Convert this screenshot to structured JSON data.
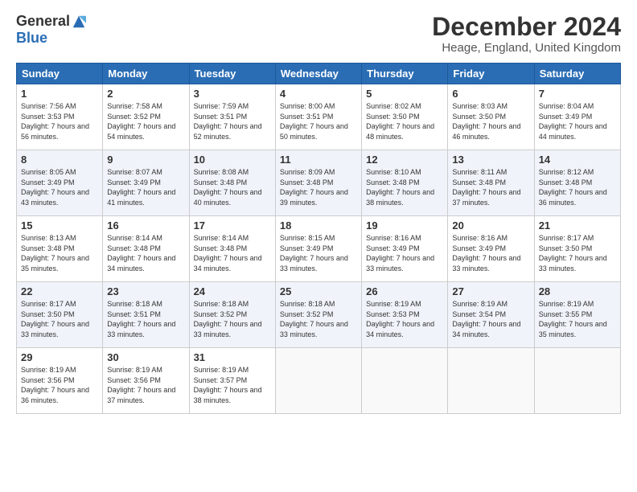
{
  "logo": {
    "general": "General",
    "blue": "Blue"
  },
  "title": "December 2024",
  "location": "Heage, England, United Kingdom",
  "days_of_week": [
    "Sunday",
    "Monday",
    "Tuesday",
    "Wednesday",
    "Thursday",
    "Friday",
    "Saturday"
  ],
  "weeks": [
    [
      {
        "day": "1",
        "sunrise": "Sunrise: 7:56 AM",
        "sunset": "Sunset: 3:53 PM",
        "daylight": "Daylight: 7 hours and 56 minutes."
      },
      {
        "day": "2",
        "sunrise": "Sunrise: 7:58 AM",
        "sunset": "Sunset: 3:52 PM",
        "daylight": "Daylight: 7 hours and 54 minutes."
      },
      {
        "day": "3",
        "sunrise": "Sunrise: 7:59 AM",
        "sunset": "Sunset: 3:51 PM",
        "daylight": "Daylight: 7 hours and 52 minutes."
      },
      {
        "day": "4",
        "sunrise": "Sunrise: 8:00 AM",
        "sunset": "Sunset: 3:51 PM",
        "daylight": "Daylight: 7 hours and 50 minutes."
      },
      {
        "day": "5",
        "sunrise": "Sunrise: 8:02 AM",
        "sunset": "Sunset: 3:50 PM",
        "daylight": "Daylight: 7 hours and 48 minutes."
      },
      {
        "day": "6",
        "sunrise": "Sunrise: 8:03 AM",
        "sunset": "Sunset: 3:50 PM",
        "daylight": "Daylight: 7 hours and 46 minutes."
      },
      {
        "day": "7",
        "sunrise": "Sunrise: 8:04 AM",
        "sunset": "Sunset: 3:49 PM",
        "daylight": "Daylight: 7 hours and 44 minutes."
      }
    ],
    [
      {
        "day": "8",
        "sunrise": "Sunrise: 8:05 AM",
        "sunset": "Sunset: 3:49 PM",
        "daylight": "Daylight: 7 hours and 43 minutes."
      },
      {
        "day": "9",
        "sunrise": "Sunrise: 8:07 AM",
        "sunset": "Sunset: 3:49 PM",
        "daylight": "Daylight: 7 hours and 41 minutes."
      },
      {
        "day": "10",
        "sunrise": "Sunrise: 8:08 AM",
        "sunset": "Sunset: 3:48 PM",
        "daylight": "Daylight: 7 hours and 40 minutes."
      },
      {
        "day": "11",
        "sunrise": "Sunrise: 8:09 AM",
        "sunset": "Sunset: 3:48 PM",
        "daylight": "Daylight: 7 hours and 39 minutes."
      },
      {
        "day": "12",
        "sunrise": "Sunrise: 8:10 AM",
        "sunset": "Sunset: 3:48 PM",
        "daylight": "Daylight: 7 hours and 38 minutes."
      },
      {
        "day": "13",
        "sunrise": "Sunrise: 8:11 AM",
        "sunset": "Sunset: 3:48 PM",
        "daylight": "Daylight: 7 hours and 37 minutes."
      },
      {
        "day": "14",
        "sunrise": "Sunrise: 8:12 AM",
        "sunset": "Sunset: 3:48 PM",
        "daylight": "Daylight: 7 hours and 36 minutes."
      }
    ],
    [
      {
        "day": "15",
        "sunrise": "Sunrise: 8:13 AM",
        "sunset": "Sunset: 3:48 PM",
        "daylight": "Daylight: 7 hours and 35 minutes."
      },
      {
        "day": "16",
        "sunrise": "Sunrise: 8:14 AM",
        "sunset": "Sunset: 3:48 PM",
        "daylight": "Daylight: 7 hours and 34 minutes."
      },
      {
        "day": "17",
        "sunrise": "Sunrise: 8:14 AM",
        "sunset": "Sunset: 3:48 PM",
        "daylight": "Daylight: 7 hours and 34 minutes."
      },
      {
        "day": "18",
        "sunrise": "Sunrise: 8:15 AM",
        "sunset": "Sunset: 3:49 PM",
        "daylight": "Daylight: 7 hours and 33 minutes."
      },
      {
        "day": "19",
        "sunrise": "Sunrise: 8:16 AM",
        "sunset": "Sunset: 3:49 PM",
        "daylight": "Daylight: 7 hours and 33 minutes."
      },
      {
        "day": "20",
        "sunrise": "Sunrise: 8:16 AM",
        "sunset": "Sunset: 3:49 PM",
        "daylight": "Daylight: 7 hours and 33 minutes."
      },
      {
        "day": "21",
        "sunrise": "Sunrise: 8:17 AM",
        "sunset": "Sunset: 3:50 PM",
        "daylight": "Daylight: 7 hours and 33 minutes."
      }
    ],
    [
      {
        "day": "22",
        "sunrise": "Sunrise: 8:17 AM",
        "sunset": "Sunset: 3:50 PM",
        "daylight": "Daylight: 7 hours and 33 minutes."
      },
      {
        "day": "23",
        "sunrise": "Sunrise: 8:18 AM",
        "sunset": "Sunset: 3:51 PM",
        "daylight": "Daylight: 7 hours and 33 minutes."
      },
      {
        "day": "24",
        "sunrise": "Sunrise: 8:18 AM",
        "sunset": "Sunset: 3:52 PM",
        "daylight": "Daylight: 7 hours and 33 minutes."
      },
      {
        "day": "25",
        "sunrise": "Sunrise: 8:18 AM",
        "sunset": "Sunset: 3:52 PM",
        "daylight": "Daylight: 7 hours and 33 minutes."
      },
      {
        "day": "26",
        "sunrise": "Sunrise: 8:19 AM",
        "sunset": "Sunset: 3:53 PM",
        "daylight": "Daylight: 7 hours and 34 minutes."
      },
      {
        "day": "27",
        "sunrise": "Sunrise: 8:19 AM",
        "sunset": "Sunset: 3:54 PM",
        "daylight": "Daylight: 7 hours and 34 minutes."
      },
      {
        "day": "28",
        "sunrise": "Sunrise: 8:19 AM",
        "sunset": "Sunset: 3:55 PM",
        "daylight": "Daylight: 7 hours and 35 minutes."
      }
    ],
    [
      {
        "day": "29",
        "sunrise": "Sunrise: 8:19 AM",
        "sunset": "Sunset: 3:56 PM",
        "daylight": "Daylight: 7 hours and 36 minutes."
      },
      {
        "day": "30",
        "sunrise": "Sunrise: 8:19 AM",
        "sunset": "Sunset: 3:56 PM",
        "daylight": "Daylight: 7 hours and 37 minutes."
      },
      {
        "day": "31",
        "sunrise": "Sunrise: 8:19 AM",
        "sunset": "Sunset: 3:57 PM",
        "daylight": "Daylight: 7 hours and 38 minutes."
      },
      null,
      null,
      null,
      null
    ]
  ]
}
